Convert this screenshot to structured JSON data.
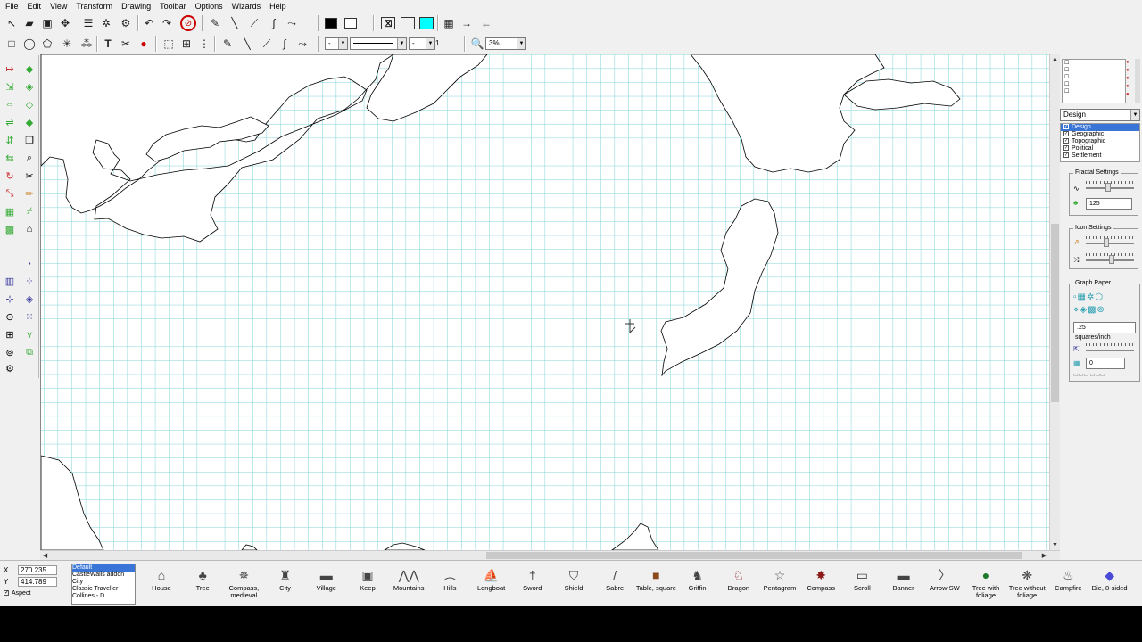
{
  "menu": [
    "File",
    "Edit",
    "View",
    "Transform",
    "Drawing",
    "Toolbar",
    "Options",
    "Wizards",
    "Help"
  ],
  "toolbar": {
    "color_fill": "#000000",
    "color_secondary": "#ffffff",
    "color_accent": "#00ffff",
    "line_style": "-",
    "line_width": "1",
    "zoom": "3%"
  },
  "right_panel": {
    "layer_dropdown": "Design",
    "layers": [
      {
        "name": "Design",
        "selected": true,
        "checked": true
      },
      {
        "name": "Geographic",
        "selected": false,
        "checked": true
      },
      {
        "name": "Topographic",
        "selected": false,
        "checked": true
      },
      {
        "name": "Political",
        "selected": false,
        "checked": true
      },
      {
        "name": "Settlement",
        "selected": false,
        "checked": true
      }
    ],
    "fractal_title": "Fractal Settings",
    "fractal_value": "125",
    "icon_title": "Icon Settings",
    "graph_title": "Graph Paper",
    "graph_value": ".25",
    "graph_units": "squares/inch",
    "graph_offset": "0"
  },
  "status": {
    "x_label": "X",
    "y_label": "Y",
    "x_value": "270.235",
    "y_value": "414.789",
    "aspect_label": "Aspect",
    "aspect_checked": true
  },
  "catalog": [
    "Default",
    "CastleWalls addon",
    "City",
    "Classic Traveller",
    "Collines - D"
  ],
  "symbols": [
    {
      "label": "House",
      "icon": "house-icon",
      "glyph": "⌂"
    },
    {
      "label": "Tree",
      "icon": "tree-icon",
      "glyph": "♣"
    },
    {
      "label": "Compass, medieval",
      "icon": "compass-medieval-icon",
      "glyph": "✵"
    },
    {
      "label": "City",
      "icon": "city-icon",
      "glyph": "♜"
    },
    {
      "label": "Village",
      "icon": "village-icon",
      "glyph": "▬"
    },
    {
      "label": "Keep",
      "icon": "keep-icon",
      "glyph": "▣"
    },
    {
      "label": "Mountains",
      "icon": "mountains-icon",
      "glyph": "⋀⋀"
    },
    {
      "label": "Hills",
      "icon": "hills-icon",
      "glyph": "︵"
    },
    {
      "label": "Longboat",
      "icon": "longboat-icon",
      "glyph": "⛵"
    },
    {
      "label": "Sword",
      "icon": "sword-icon",
      "glyph": "†"
    },
    {
      "label": "Shield",
      "icon": "shield-icon",
      "glyph": "⛉"
    },
    {
      "label": "Sabre",
      "icon": "sabre-icon",
      "glyph": "/"
    },
    {
      "label": "Table, square",
      "icon": "table-square-icon",
      "glyph": "■"
    },
    {
      "label": "Griffin",
      "icon": "griffin-icon",
      "glyph": "♞"
    },
    {
      "label": "Dragon",
      "icon": "dragon-icon",
      "glyph": "♘"
    },
    {
      "label": "Pentagram",
      "icon": "pentagram-icon",
      "glyph": "☆"
    },
    {
      "label": "Compass",
      "icon": "compass-icon",
      "glyph": "✸"
    },
    {
      "label": "Scroll",
      "icon": "scroll-icon",
      "glyph": "▭"
    },
    {
      "label": "Banner",
      "icon": "banner-icon",
      "glyph": "▬"
    },
    {
      "label": "Arrow SW",
      "icon": "arrow-icon",
      "glyph": "〉"
    },
    {
      "label": "Tree with foliage",
      "icon": "tree-foliage-icon",
      "glyph": "●"
    },
    {
      "label": "Tree without foliage",
      "icon": "tree-bare-icon",
      "glyph": "❋"
    },
    {
      "label": "Campfire",
      "icon": "campfire-icon",
      "glyph": "♨"
    },
    {
      "label": "Die, 8-sided",
      "icon": "die-icon",
      "glyph": "◆"
    }
  ],
  "colors": {
    "grid": "#7fd3d9",
    "coast": "#000000",
    "land": "#ffffff",
    "table_brown": "#8b4a1c",
    "tree_green": "#1b7a2a",
    "dragon_red": "#8b1a1a",
    "die_blue": "#4a4ad8"
  }
}
